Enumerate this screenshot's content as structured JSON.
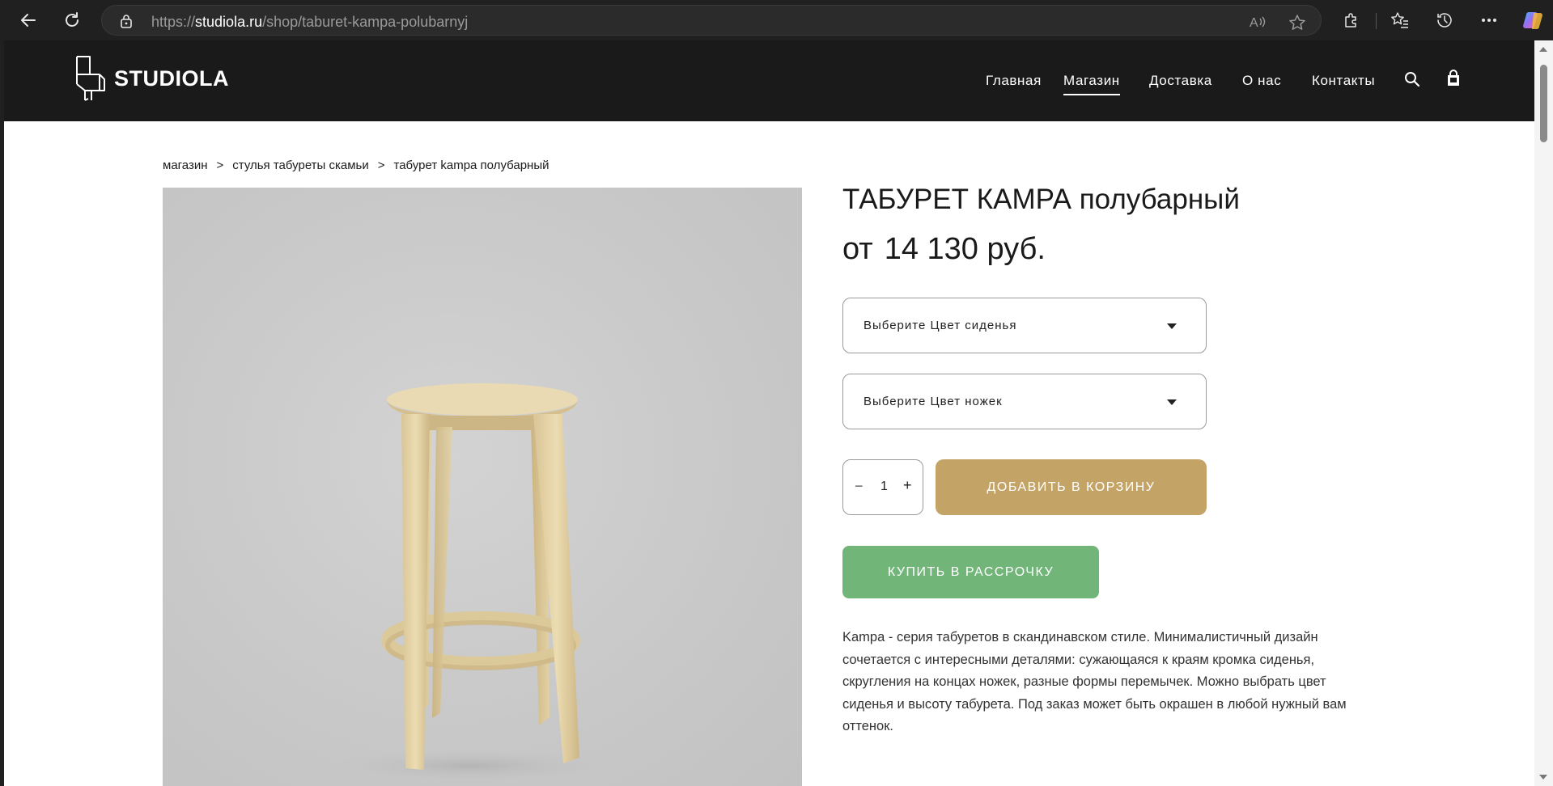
{
  "browser": {
    "url_prefix": "https://",
    "url_domain": "studiola.ru",
    "url_path": "/shop/taburet-kampa-polubarnyj"
  },
  "header": {
    "logo_text": "STUDIOLA",
    "menu": [
      {
        "label": "Главная"
      },
      {
        "label": "Магазин",
        "active": true
      },
      {
        "label": "Доставка"
      },
      {
        "label": "О нас"
      },
      {
        "label": "Контакты"
      }
    ]
  },
  "breadcrumb": {
    "items": [
      "магазин",
      "стулья табуреты скамьи",
      "табурет kampa полубарный"
    ],
    "separator": ">"
  },
  "product": {
    "title": "ТАБУРЕТ КАМРА полубарный",
    "price_prefix": "от",
    "price": "14 130 руб.",
    "seat_color_select": "Выберите Цвет сиденья",
    "leg_color_select": "Выберите Цвет ножек",
    "quantity": "1",
    "qty_minus": "−",
    "qty_plus": "+",
    "add_to_cart": "ДОБАВИТЬ В КОРЗИНУ",
    "buy_credit": "КУПИТЬ В РАССРОЧКУ",
    "description": "Kampa - серия табуретов в скандинавском стиле. Минималистичный дизайн сочетается с интересными деталями: сужающаяся к краям кромка сиденья, скругления на концах ножек, разные формы перемычек. Можно выбрать цвет сиденья и высоту табурета. Под заказ может быть окрашен в любой нужный вам оттенок."
  },
  "colors": {
    "header_bg": "#1a1a1a",
    "cart_button": "#c4a466",
    "credit_button": "#72b578",
    "image_bg": "#cbcbcb"
  }
}
